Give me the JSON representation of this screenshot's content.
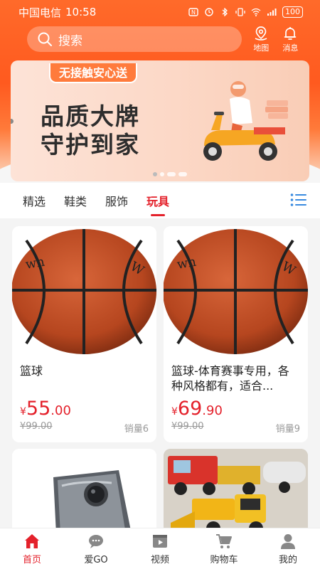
{
  "status_bar": {
    "carrier": "中国电信",
    "time": "10:58",
    "battery": "100"
  },
  "search": {
    "placeholder": "搜索"
  },
  "top_actions": {
    "map_label": "地图",
    "message_label": "消息"
  },
  "banner": {
    "tag": "无接触安心送",
    "line1": "品质大牌",
    "line2": "守护到家"
  },
  "tabs": [
    {
      "label": "精选",
      "active": false
    },
    {
      "label": "鞋类",
      "active": false
    },
    {
      "label": "服饰",
      "active": false
    },
    {
      "label": "玩具",
      "active": true
    }
  ],
  "products": [
    {
      "name": "篮球",
      "price_int": "55",
      "price_dec": ".00",
      "currency": "¥",
      "old_price": "¥99.00",
      "sales": "销量6",
      "image": "basketball"
    },
    {
      "name": "篮球-体育赛事专用，各种风格都有，适合...",
      "price_int": "69",
      "price_dec": ".90",
      "currency": "¥",
      "old_price": "¥99.00",
      "sales": "销量9",
      "image": "basketball"
    },
    {
      "name": "",
      "image": "foldable-phone"
    },
    {
      "name": "",
      "image": "toy-construction-trucks"
    }
  ],
  "bottom_nav": [
    {
      "label": "首页",
      "icon": "home-icon",
      "active": true
    },
    {
      "label": "爱GO",
      "icon": "chat-icon",
      "active": false
    },
    {
      "label": "视频",
      "icon": "video-icon",
      "active": false
    },
    {
      "label": "购物车",
      "icon": "cart-icon",
      "active": false
    },
    {
      "label": "我的",
      "icon": "user-icon",
      "active": false
    }
  ],
  "colors": {
    "brand": "#ff5a1f",
    "accent": "#e4212b",
    "banner_bg": "#fcd9c8"
  }
}
